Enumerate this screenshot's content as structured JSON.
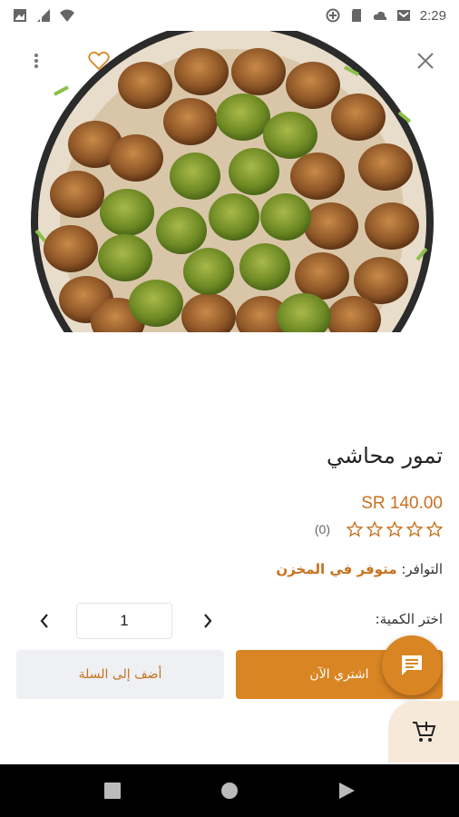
{
  "status_bar": {
    "time": "2:29",
    "left_icons": [
      "photos-icon",
      "signal-icon",
      "wifi-icon"
    ],
    "right_icons": [
      "data-saver-icon",
      "sd-card-icon",
      "cloud-icon",
      "gmail-icon"
    ]
  },
  "top_actions": {
    "menu_icon": "more-vert-icon",
    "favorite_icon": "heart-outline-icon",
    "close_icon": "close-icon"
  },
  "product": {
    "title": "تمور محاشي",
    "price": "SR 140.00",
    "rating": 0,
    "max_rating": 5,
    "review_count": "(0)",
    "availability_label": "التوافر:",
    "availability_value": "متوفر في المخزن"
  },
  "quantity": {
    "label": "اختر الكمية:",
    "value": "1"
  },
  "actions": {
    "buy_now_label": "اشتري الآن",
    "add_to_cart_label": "أضف إلى السلة"
  },
  "floating": {
    "chat_icon": "chat-icon",
    "cart_icon": "add-cart-icon"
  },
  "colors": {
    "accent": "#d98523",
    "price": "#c8711f",
    "star": "#c8711f",
    "secondary_button_bg": "#eef0f3"
  },
  "nav_bar": {
    "buttons": [
      "recents-icon",
      "home-icon",
      "back-icon"
    ]
  }
}
